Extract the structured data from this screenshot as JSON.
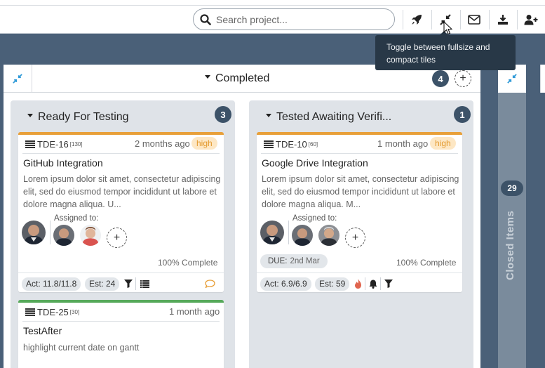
{
  "toolbar": {
    "search_placeholder": "Search project...",
    "icons": [
      "rocket-icon",
      "compress-icon",
      "mail-icon",
      "download-icon",
      "add-user-icon"
    ]
  },
  "tooltip": {
    "text": "Toggle between fullsize and compact tiles"
  },
  "lane": {
    "title": "Completed",
    "count": "4"
  },
  "closed_lane": {
    "count": "29",
    "label": "Closed Items"
  },
  "columns": [
    {
      "title": "Ready For Testing",
      "count": "3",
      "cards": [
        {
          "id": "TDE-16",
          "points": "[130]",
          "time": "2 months ago",
          "priority": "high",
          "title": "GitHub Integration",
          "description": "Lorem ipsum dolor sit amet, consectetur adipiscing elit, sed do eiusmod tempor incididunt ut labore et dolore magna aliqua. U...",
          "assigned_label": "Assigned to:",
          "progress": "100% Complete",
          "act": "Act: 11.8/11.8",
          "est": "Est: 24"
        },
        {
          "id": "TDE-25",
          "points": "[30]",
          "time": "1 month ago",
          "title": "TestAfter",
          "description": "highlight current date on gantt"
        }
      ]
    },
    {
      "title": "Tested Awaiting Verifi...",
      "count": "1",
      "cards": [
        {
          "id": "TDE-10",
          "points": "[60]",
          "time": "1 month ago",
          "priority": "high",
          "title": "Google Drive Integration",
          "description": "Lorem ipsum dolor sit amet, consectetur adipiscing elit, sed do eiusmod tempor incididunt ut labore et dolore magna aliqua. M...",
          "assigned_label": "Assigned to:",
          "due_label": "DUE:",
          "due_value": "2nd Mar",
          "progress": "100% Complete",
          "act": "Act: 6.9/6.9",
          "est": "Est: 59"
        }
      ]
    }
  ],
  "colors": {
    "board_bg": "#4a6078",
    "badge": "#3c5268",
    "priority_text": "#e49a2e",
    "priority_bg": "#fde7c4",
    "card_top_orange": "#e8a03a",
    "card_top_green": "#56a95a"
  }
}
